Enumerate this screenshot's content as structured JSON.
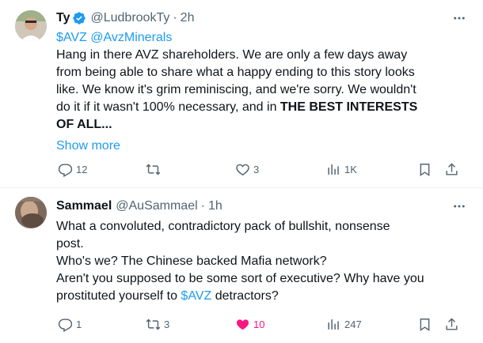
{
  "tweets": [
    {
      "name": "Ty",
      "handle": "@LudbrookTy",
      "dot": "·",
      "time": "2h",
      "lines": [
        [
          "$AVZ @AvzMinerals"
        ],
        [
          "Hang in there AVZ shareholders. We are only a few days away"
        ],
        [
          "from being able to share what a happy ending to this story looks"
        ],
        [
          "like. We know it's grim reminiscing, and we're sorry. We wouldn't"
        ],
        [
          "do it if it wasn't 100% necessary, and in ",
          "THE BEST INTERESTS"
        ],
        [
          "OF ALL..."
        ]
      ],
      "link_text": "$AVZ @AvzMinerals",
      "body_lines": [
        "Hang in there AVZ shareholders. We are only a few days away",
        "from being able to share what a happy ending to this story looks",
        "like. We know it's grim reminiscing, and we're sorry. We wouldn't"
      ],
      "line4_normal": "do it if it wasn't 100% necessary, and in ",
      "line4_bold": "THE BEST INTERESTS",
      "line5_bold": "OF ALL...",
      "show_more": "Show more",
      "replies": "12",
      "retweets": "",
      "likes": "3",
      "views": "1K"
    },
    {
      "name": "Sammael",
      "handle": "@AuSammael",
      "dot": "·",
      "time": "1h",
      "body_lines": [
        "What a convoluted, contradictory pack of bullshit, nonsense",
        "post.",
        "Who's we? The Chinese backed Mafia network?",
        "Aren't you supposed to be some sort of executive? Why have you"
      ],
      "last_line_before": "prostituted yourself to ",
      "last_line_link": "$AVZ",
      "last_line_after": " detractors?",
      "replies": "1",
      "retweets": "3",
      "likes": "10",
      "views": "247"
    }
  ],
  "colors": {
    "accent": "#1d9bf0",
    "like_active": "#f91880",
    "secondary_text": "#536471"
  }
}
